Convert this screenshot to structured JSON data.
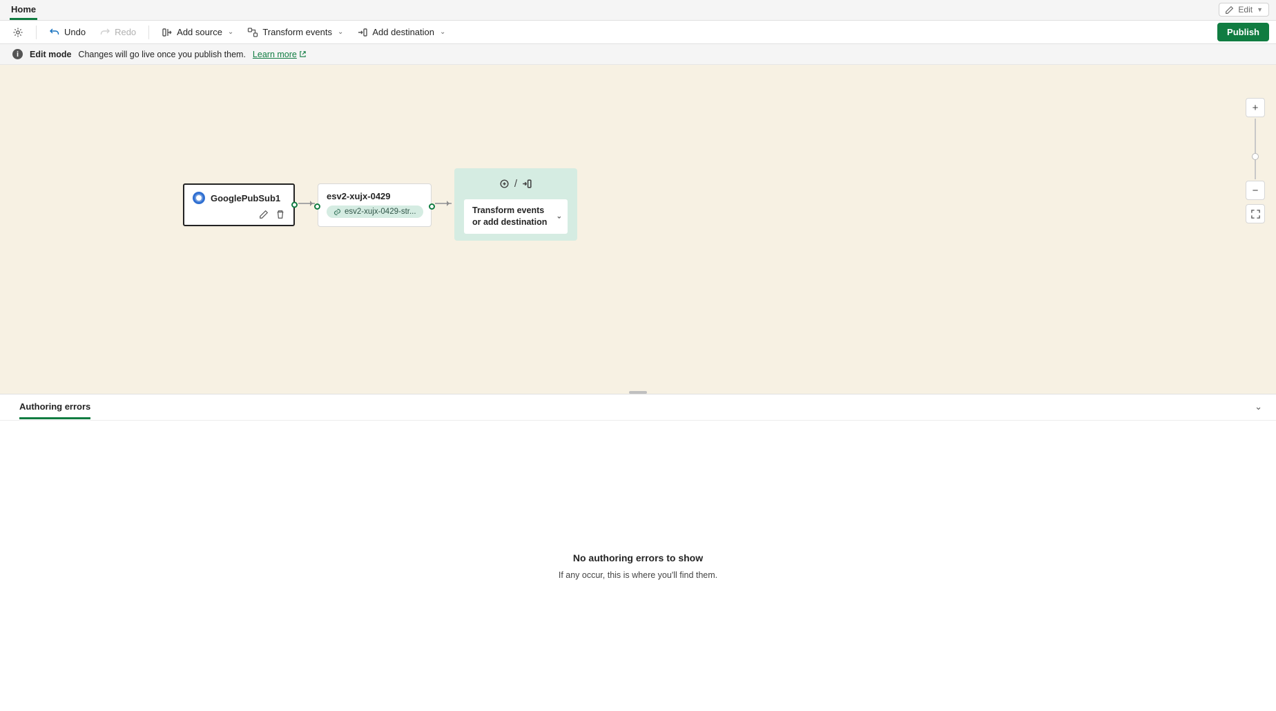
{
  "tabs": {
    "home": "Home"
  },
  "edit_pill": {
    "label": "Edit"
  },
  "toolbar": {
    "undo": "Undo",
    "redo": "Redo",
    "add_source": "Add source",
    "transform": "Transform events",
    "add_dest": "Add destination",
    "publish": "Publish"
  },
  "banner": {
    "mode": "Edit mode",
    "msg": "Changes will go live once you publish them.",
    "learn_more": "Learn more"
  },
  "nodes": {
    "source": {
      "title": "GooglePubSub1"
    },
    "stream": {
      "title": "esv2-xujx-0429",
      "chip": "esv2-xujx-0429-str..."
    },
    "next": {
      "label": "Transform events or add destination"
    }
  },
  "panel": {
    "tab": "Authoring errors",
    "empty_title": "No authoring errors to show",
    "empty_sub": "If any occur, this is where you'll find them."
  }
}
